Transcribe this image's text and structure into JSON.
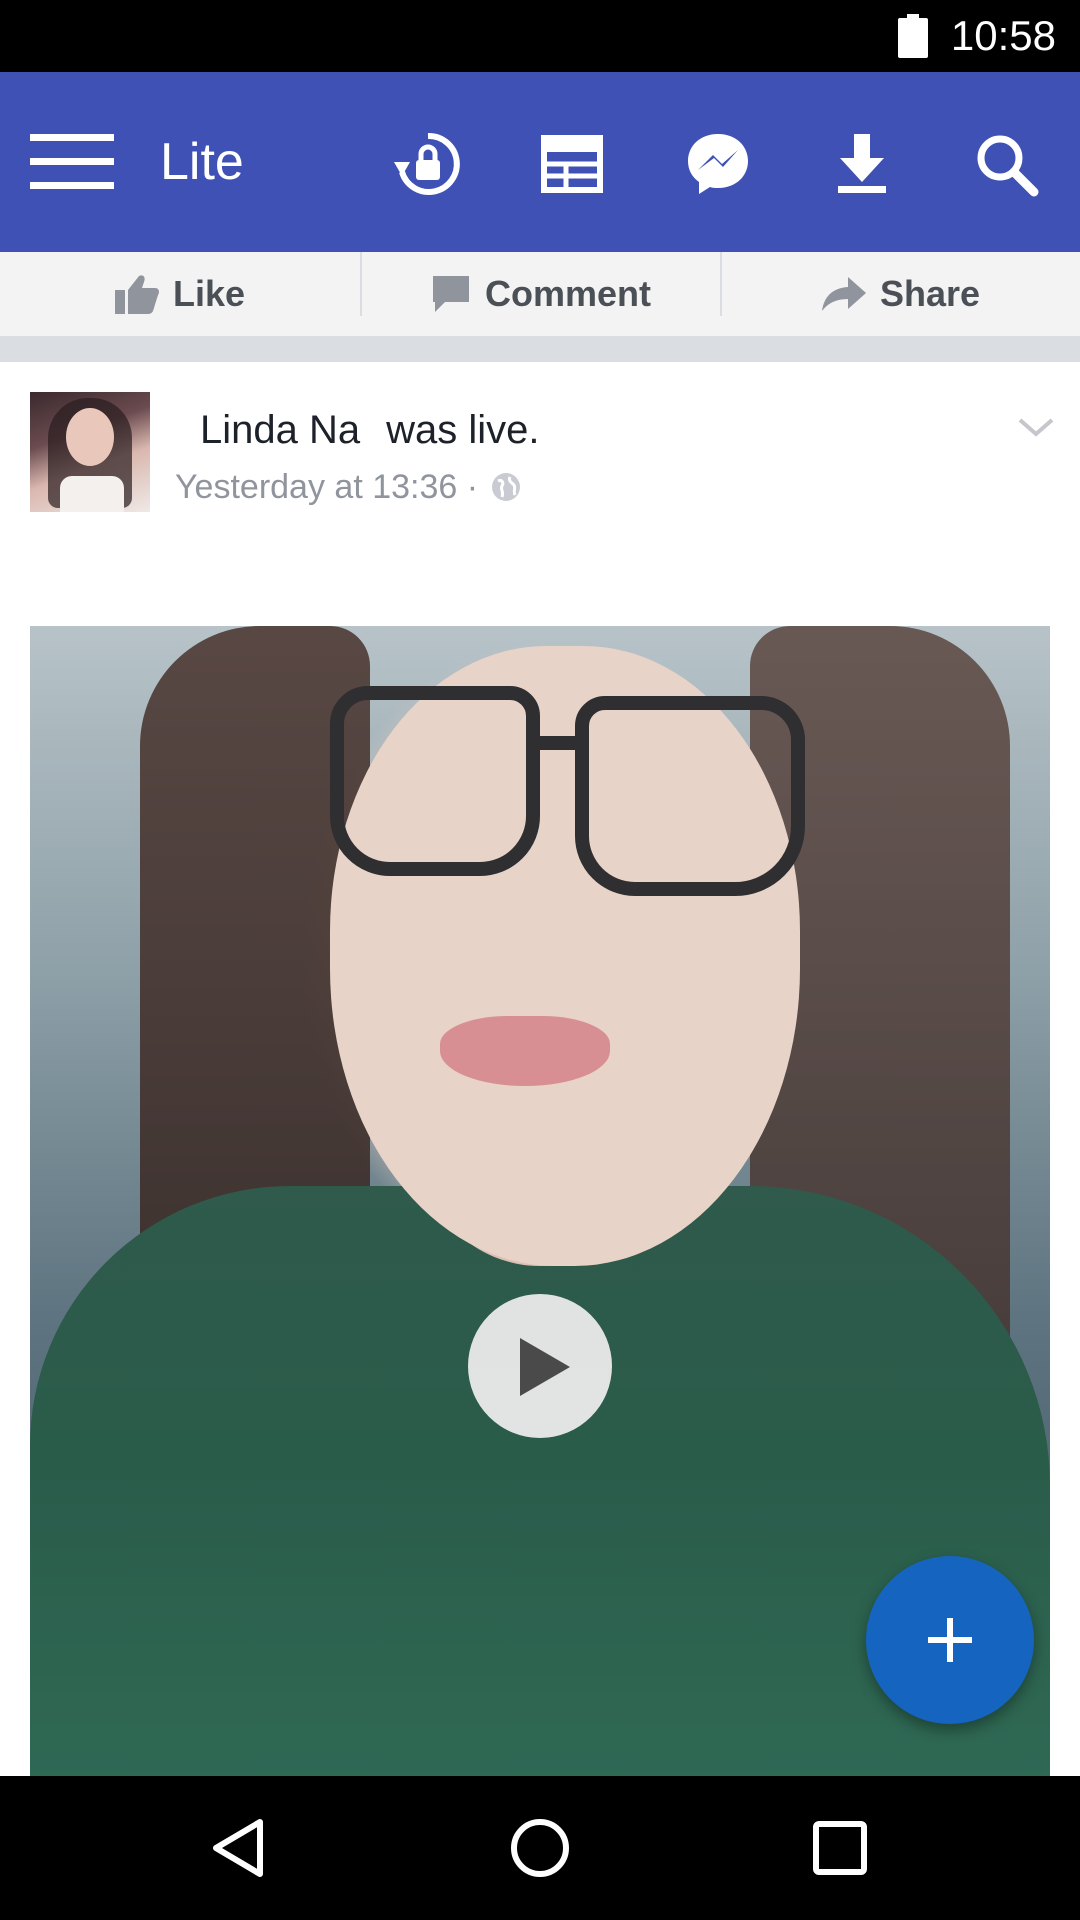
{
  "status_bar": {
    "time": "10:58",
    "battery_icon": "battery-full-icon"
  },
  "app_bar": {
    "title": "Lite",
    "icons": [
      "menu-icon",
      "privacy-lock-icon",
      "news-feed-icon",
      "messenger-icon",
      "download-icon",
      "search-icon"
    ],
    "color": "#3f51b5"
  },
  "actions": {
    "like_label": "Like",
    "comment_label": "Comment",
    "share_label": "Share"
  },
  "post": {
    "author": "Linda Na",
    "action_text": "was live.",
    "timestamp": "Yesterday at 13:36 ·",
    "audience_icon": "globe-icon",
    "options_icon": "chevron-down-icon",
    "media_type": "video",
    "play_icon": "play-icon"
  },
  "fab": {
    "icon": "plus-icon",
    "color": "#1565c0"
  },
  "nav_bar": {
    "icons": [
      "back-icon",
      "home-icon",
      "recents-icon"
    ]
  }
}
